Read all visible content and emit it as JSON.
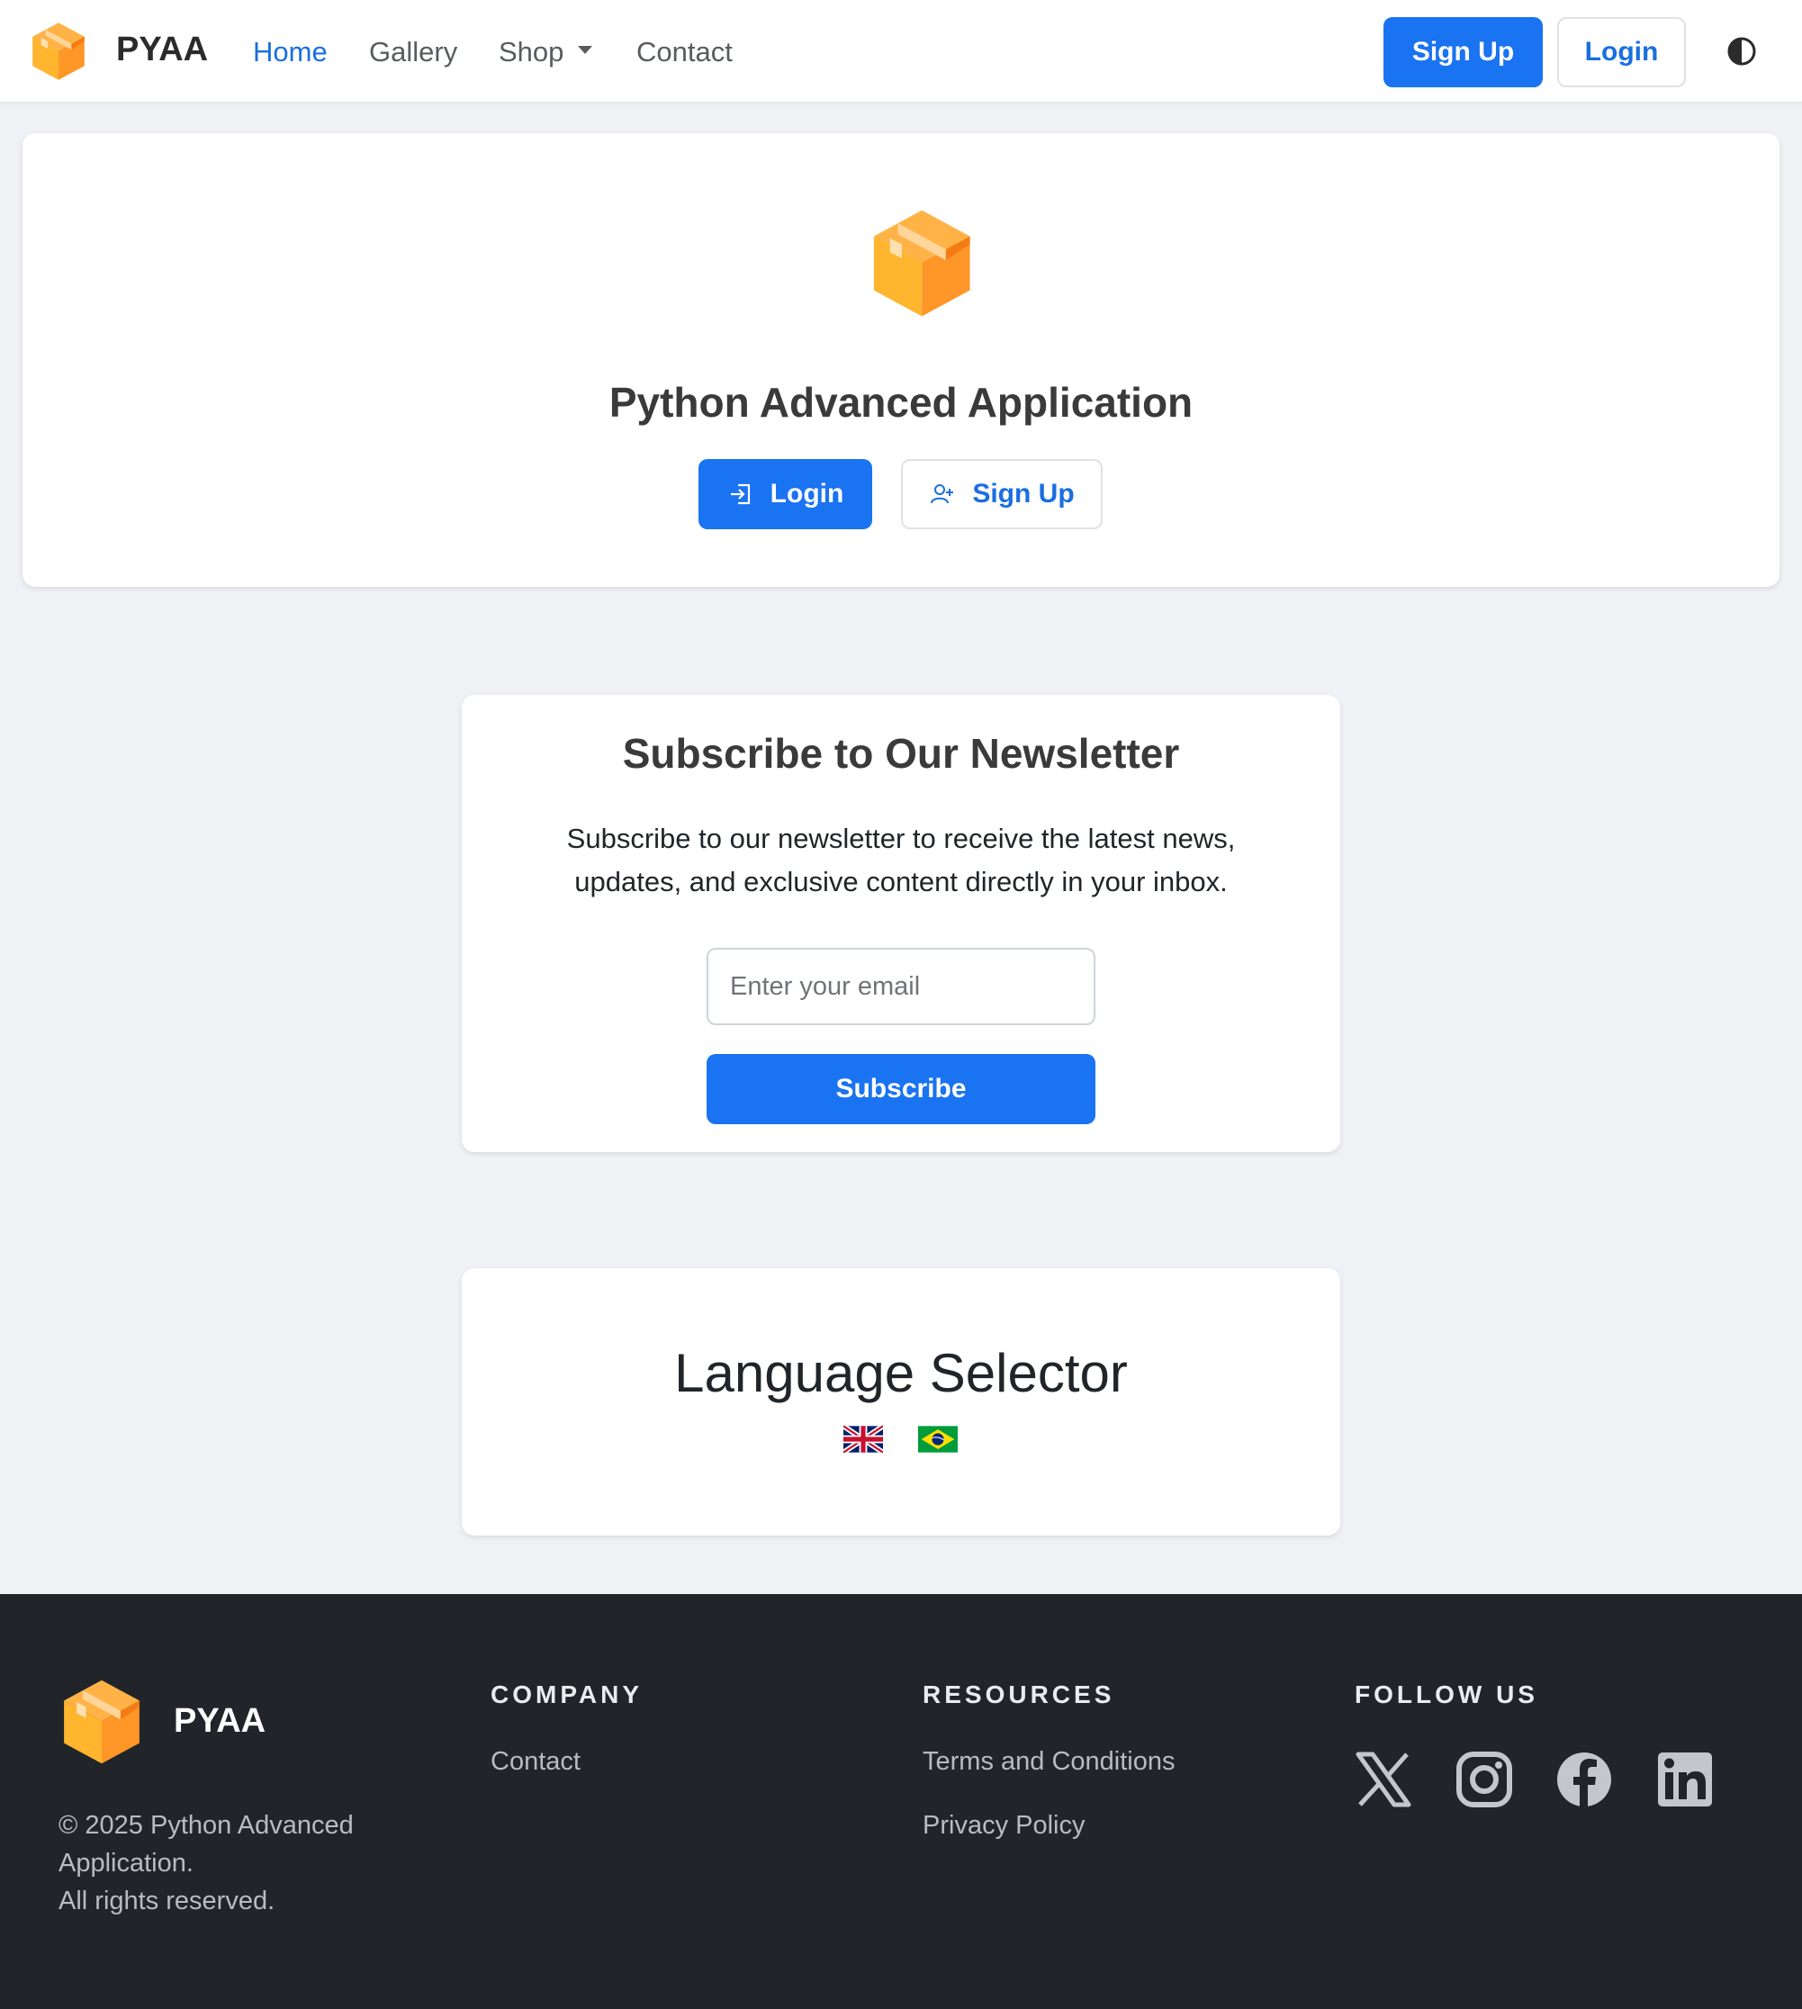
{
  "navbar": {
    "brand": "PYAA",
    "links": [
      "Home",
      "Gallery",
      "Shop",
      "Contact"
    ],
    "signup_label": "Sign Up",
    "login_label": "Login"
  },
  "hero": {
    "title": "Python Advanced Application",
    "login_label": "Login",
    "signup_label": "Sign Up"
  },
  "newsletter": {
    "title": "Subscribe to Our Newsletter",
    "line1": "Subscribe to our newsletter to receive the latest news,",
    "line2": "updates, and exclusive content directly in your inbox.",
    "email_placeholder": "Enter your email",
    "subscribe_label": "Subscribe"
  },
  "language": {
    "title": "Language Selector",
    "flags": [
      "uk-flag-icon",
      "brazil-flag-icon"
    ]
  },
  "footer": {
    "brand": "PYAA",
    "copyright_1": "© 2025 Python Advanced",
    "copyright_2": "Application.",
    "copyright_3": "All rights reserved.",
    "company_head": "COMPANY",
    "company_links": [
      "Contact"
    ],
    "resources_head": "RESOURCES",
    "resources_links": [
      "Terms and Conditions",
      "Privacy Policy"
    ],
    "follow_head": "FOLLOW US",
    "social": [
      "x-icon",
      "instagram-icon",
      "facebook-icon",
      "linkedin-icon"
    ]
  },
  "colors": {
    "primary": "#1a73f0",
    "footer_bg": "#212529",
    "page_bg": "#f0f1f5",
    "box_orange": "#ff9f2e"
  }
}
